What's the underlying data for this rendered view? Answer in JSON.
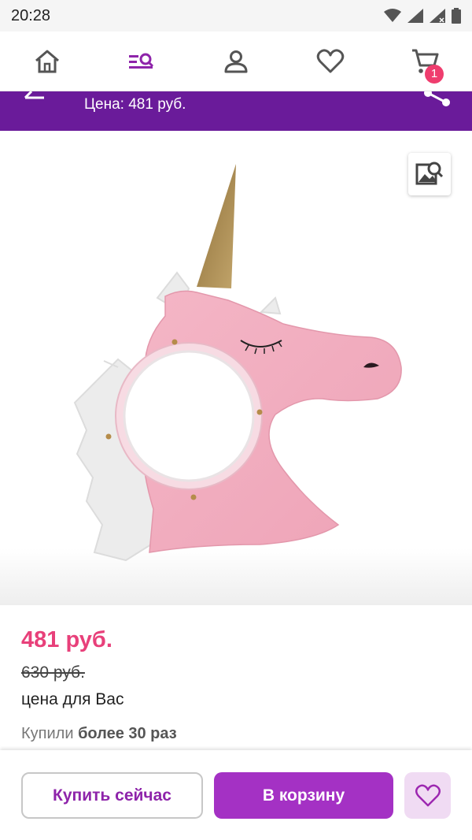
{
  "status_bar": {
    "time": "20:28"
  },
  "nav": {
    "items": [
      "home-icon",
      "catalog-search-icon",
      "profile-icon",
      "favorites-icon",
      "cart-icon"
    ],
    "cart_badge": "1"
  },
  "header": {
    "price_label": "Цена: 481 руб."
  },
  "product": {
    "price_current": "481 руб.",
    "price_old": "630 руб.",
    "price_note": "цена для Вас",
    "bought_prefix": "Купили",
    "bought_count": "более 30 раз"
  },
  "actions": {
    "buy_now": "Купить сейчас",
    "add_to_cart": "В корзину"
  },
  "colors": {
    "brand_purple": "#6a1b9a",
    "button_purple": "#a431c4",
    "price_pink": "#e8407a",
    "badge_pink": "#ef3d6e"
  }
}
